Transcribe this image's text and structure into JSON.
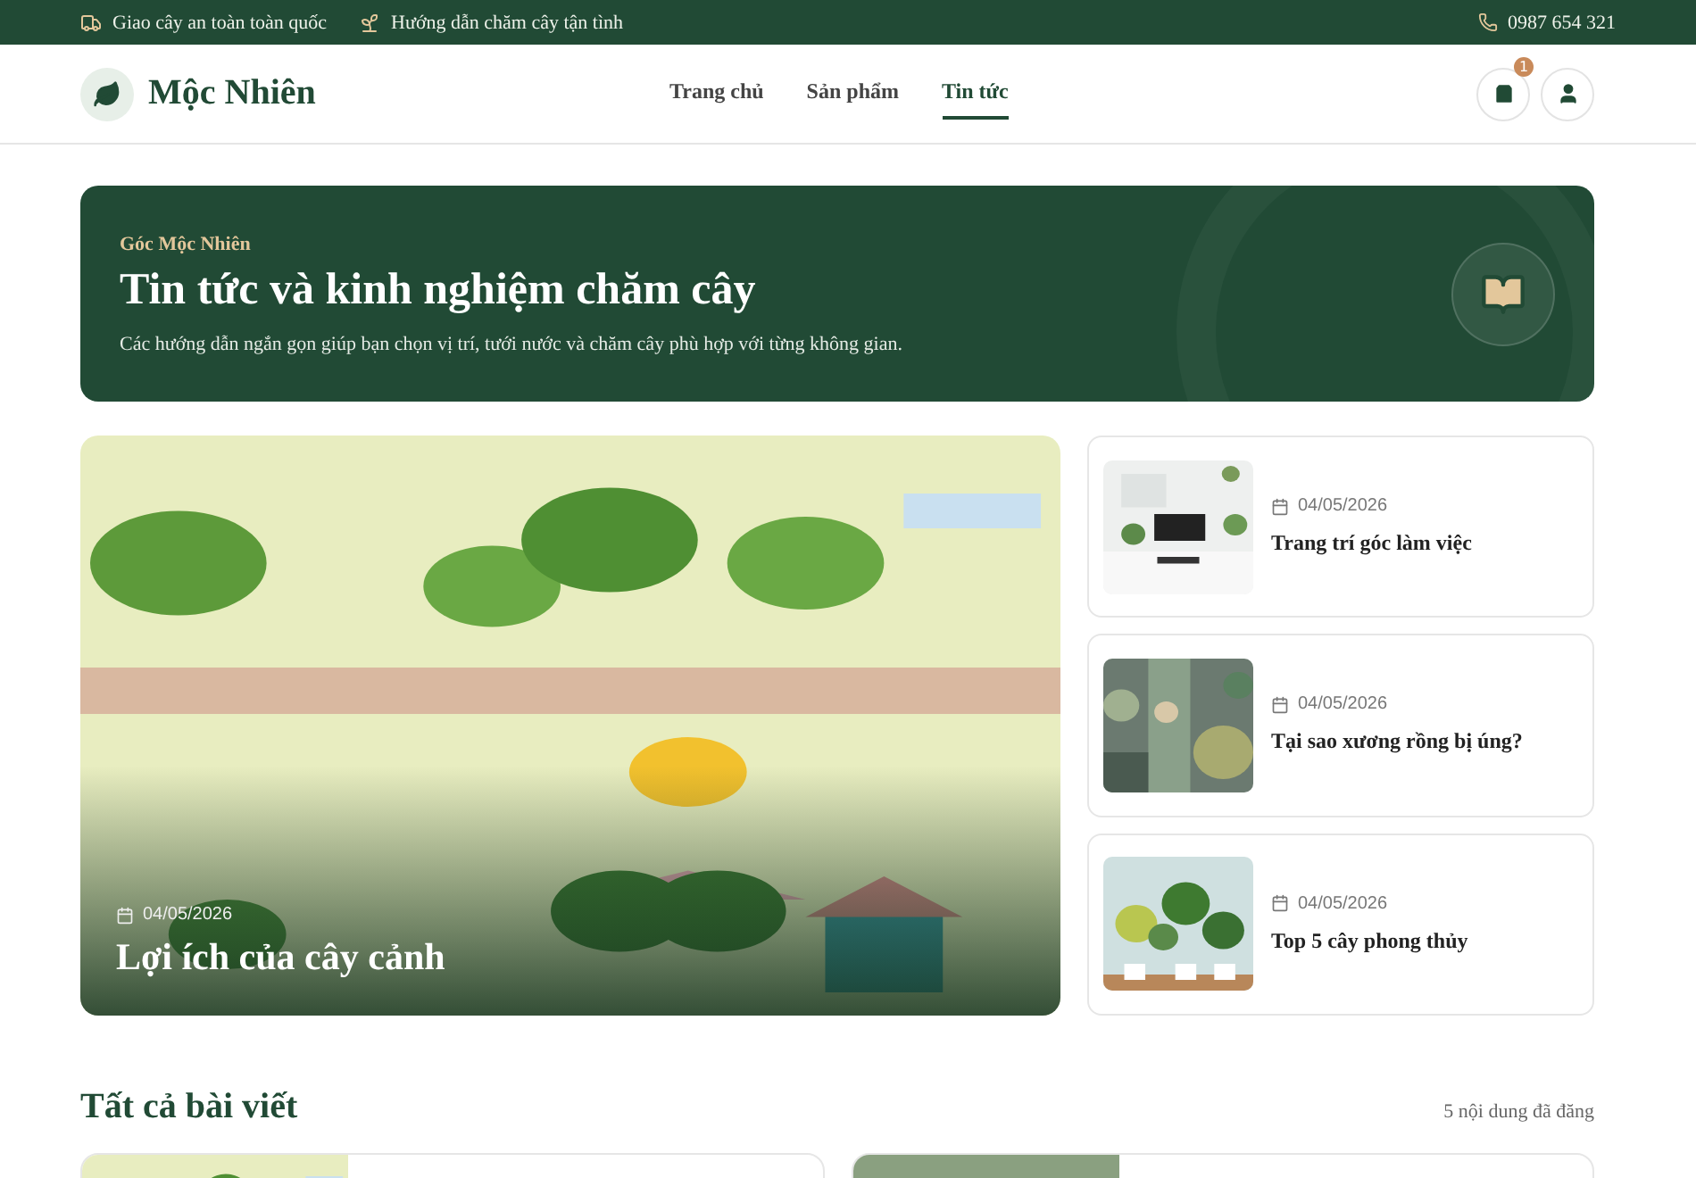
{
  "topbar": {
    "items": [
      {
        "kind": "truck",
        "text": "Giao cây an toàn toàn quốc"
      },
      {
        "kind": "sprout",
        "text": "Hướng dẫn chăm cây tận tình"
      }
    ],
    "phone": "0987 654 321"
  },
  "header": {
    "logo": "Mộc Nhiên",
    "nav": [
      {
        "label": "Trang chủ",
        "selected": false
      },
      {
        "label": "Sản phẩm",
        "selected": false
      },
      {
        "label": "Tin tức",
        "selected": true
      }
    ],
    "cart_count": "1"
  },
  "hero": {
    "eyebrow": "Góc Mộc Nhiên",
    "title": "Tin tức và kinh nghiệm chăm cây",
    "subtitle": "Các hướng dẫn ngắn gọn giúp bạn chọn vị trí, tưới nước và chăm cây phù hợp với từng không gian."
  },
  "featured": {
    "kind": "picture",
    "date": "04/05/2026",
    "title": "Lợi ích của cây cảnh"
  },
  "side_posts": [
    {
      "kind": "picture",
      "date": "04/05/2026",
      "title": "Trang trí góc làm việc"
    },
    {
      "kind": "picture",
      "date": "04/05/2026",
      "title": "Tại sao xương rồng bị úng?"
    },
    {
      "kind": "picture",
      "date": "04/05/2026",
      "title": "Top 5 cây phong thủy"
    }
  ],
  "all_posts": {
    "title": "Tất cả bài viết",
    "count": "5 nội dung đã đăng"
  }
}
